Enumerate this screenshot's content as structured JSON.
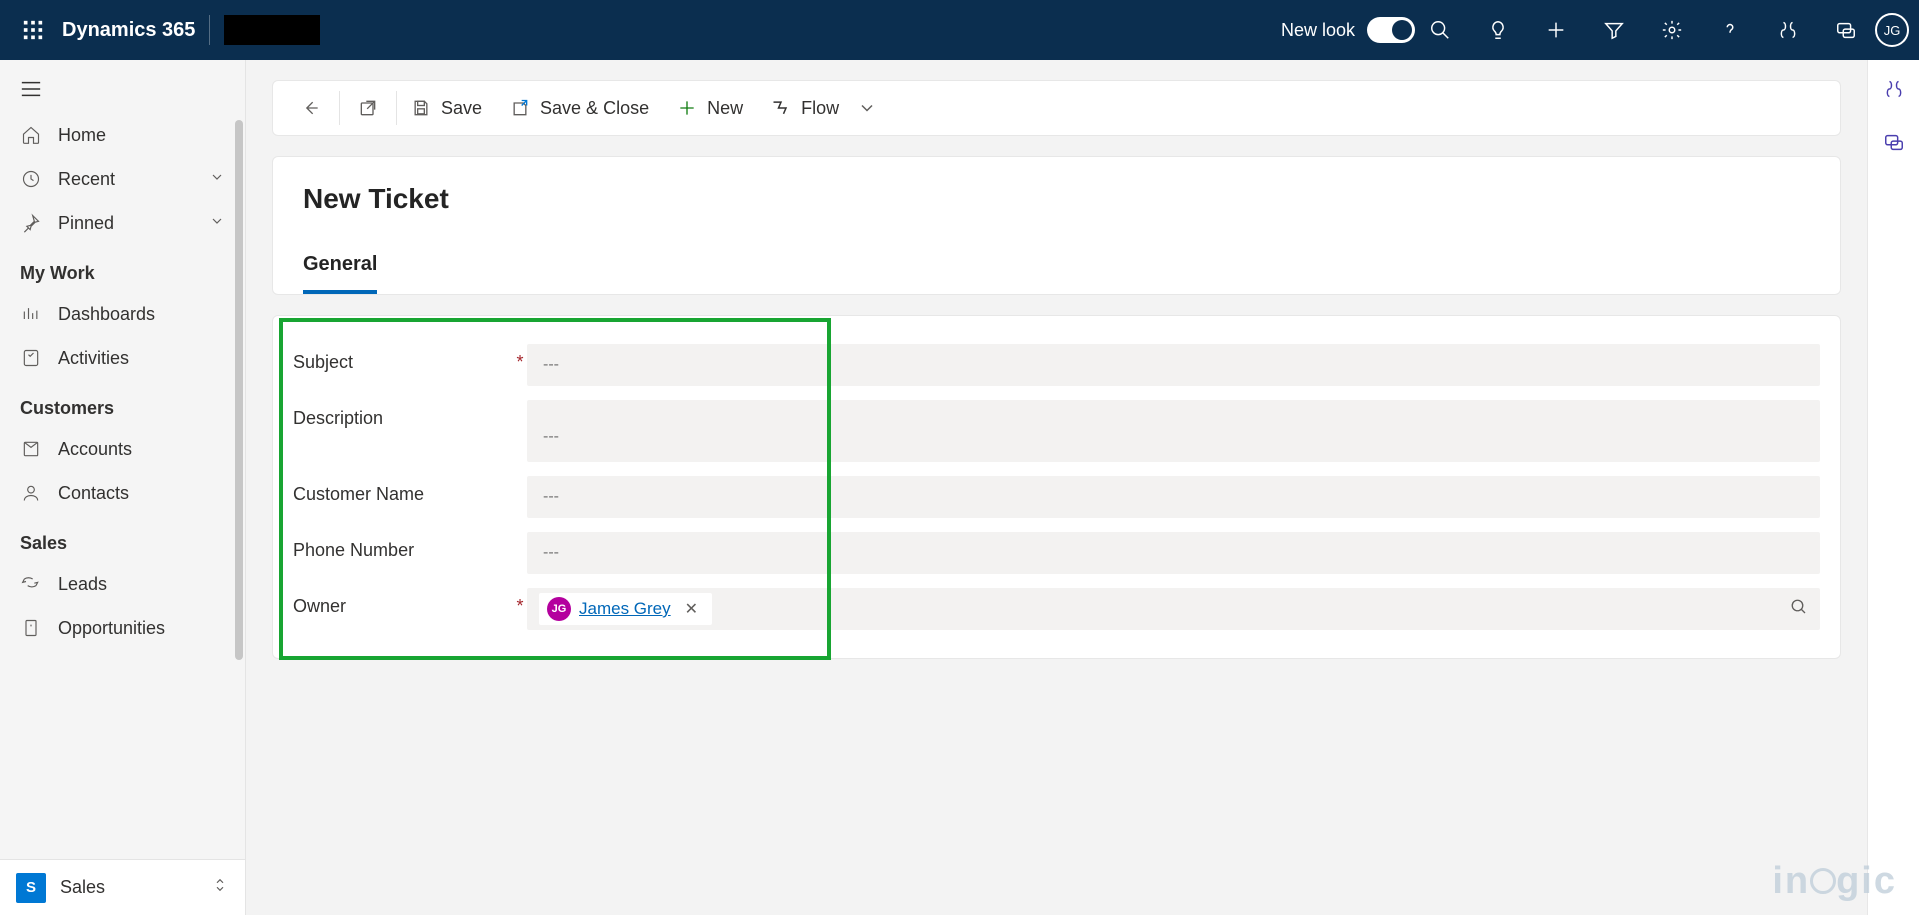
{
  "topbar": {
    "brand": "Dynamics 365",
    "new_look_label": "New look",
    "avatar_initials": "JG"
  },
  "nav": {
    "items_top": [
      {
        "label": "Home"
      },
      {
        "label": "Recent"
      },
      {
        "label": "Pinned"
      }
    ],
    "section_mywork": "My Work",
    "items_mywork": [
      {
        "label": "Dashboards"
      },
      {
        "label": "Activities"
      }
    ],
    "section_customers": "Customers",
    "items_customers": [
      {
        "label": "Accounts"
      },
      {
        "label": "Contacts"
      }
    ],
    "section_sales": "Sales",
    "items_sales": [
      {
        "label": "Leads"
      },
      {
        "label": "Opportunities"
      }
    ],
    "area": {
      "badge": "S",
      "label": "Sales"
    }
  },
  "cmdbar": {
    "save": "Save",
    "save_close": "Save & Close",
    "new": "New",
    "flow": "Flow"
  },
  "page": {
    "title": "New Ticket",
    "tab_general": "General"
  },
  "form": {
    "subject_label": "Subject",
    "subject_placeholder": "---",
    "description_label": "Description",
    "description_placeholder": "---",
    "customer_label": "Customer Name",
    "customer_placeholder": "---",
    "phone_label": "Phone Number",
    "phone_placeholder": "---",
    "owner_label": "Owner",
    "owner_initials": "JG",
    "owner_name": "James Grey",
    "required_mark": "*"
  },
  "watermark": "inogic"
}
